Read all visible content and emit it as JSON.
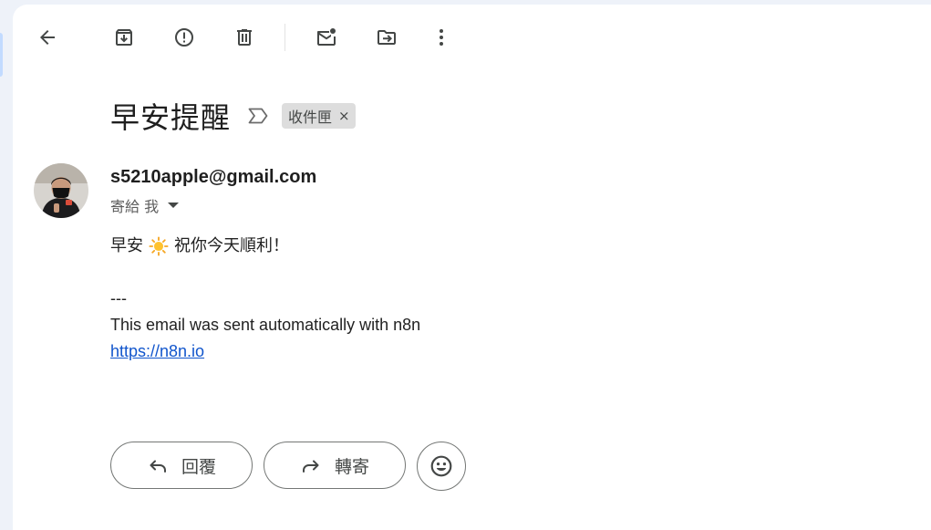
{
  "toolbar": {
    "back": "back-arrow-icon",
    "archive": "archive-icon",
    "report_spam": "report-spam-icon",
    "delete": "trash-icon",
    "mark_unread": "mark-unread-icon",
    "move_to": "move-to-folder-icon",
    "more": "more-vert-icon"
  },
  "message": {
    "subject": "早安提醒",
    "label": "收件匣",
    "label_remove": "×",
    "sender": "s5210apple@gmail.com",
    "recipient": "寄給 我",
    "greeting_before": "早安",
    "greeting_emoji": "sun-emoji",
    "greeting_after": "祝你今天順利！",
    "separator": "---",
    "footer_text": "This email was sent automatically with n8n",
    "footer_link": "https://n8n.io"
  },
  "actions": {
    "reply_label": "回覆",
    "forward_label": "轉寄",
    "emoji_reaction": "smiley-icon"
  },
  "colors": {
    "link": "#1155cc",
    "chip_bg": "#dddddd",
    "page_bg": "#eef2f9"
  }
}
